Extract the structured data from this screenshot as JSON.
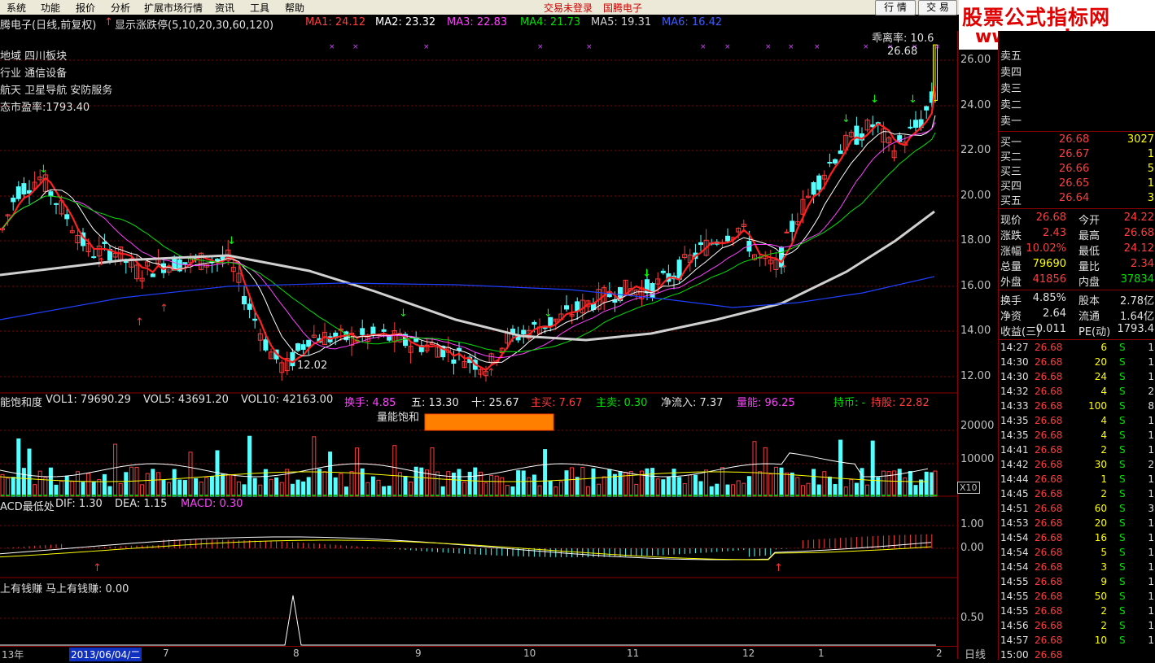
{
  "menu": [
    "系统",
    "功能",
    "报价",
    "分析",
    "扩展市场行情",
    "资讯",
    "工具",
    "帮助"
  ],
  "menu_center": [
    "交易未登录",
    "国腾电子"
  ],
  "buttons": {
    "fenshi": "行 情",
    "trade": "交 易"
  },
  "watermark": {
    "line1": "股票公式指标网",
    "line2": "www.gszb.com"
  },
  "header": {
    "stock": "腾电子(日线,前复权)",
    "toggle": "显示涨跌停(5,10,20,30,60,120)",
    "ma1": "MA1: 24.12",
    "ma2": "MA2: 23.32",
    "ma3": "MA3: 22.83",
    "ma4": "MA4: 21.73",
    "ma5": "MA5: 19.31",
    "ma6": "MA6: 16.42"
  },
  "overlay": {
    "line1": "地域 四川板块",
    "line2": "行业 通信设备",
    "line3": "航天 卫星导航 安防服务",
    "line4": "态市盈率:1793.40",
    "bias": "乖离率: 10.6",
    "high_label": "26.68",
    "low_label": "12.02"
  },
  "price_axis": [
    "26.00",
    "24.00",
    "22.00",
    "20.00",
    "18.00",
    "16.00",
    "14.00",
    "12.00"
  ],
  "vol_header": {
    "name": "能饱和度",
    "vol1": "VOL1: 79690.29",
    "vol5": "VOL5: 43691.20",
    "vol10": "VOL10: 42163.00",
    "hs": "换手: 4.85",
    "wu": "五: 13.30",
    "shi": "十: 25.67",
    "zhumai": "主买: 7.67",
    "zhumai2": "主卖: 0.30",
    "jlr": "净流入: 7.37",
    "ln": "量能: 96.25",
    "cb": "持币: -",
    "cg": "持股: 22.82",
    "bar_label": "量能饱和"
  },
  "vol_axis": [
    "20000",
    "10000",
    "X10"
  ],
  "macd_header": {
    "name": "ACD最低处",
    "dif": "DIF: 1.30",
    "dea": "DEA: 1.15",
    "macd": "MACD: 0.30"
  },
  "macd_axis": [
    "1.00",
    "0.00"
  ],
  "ind_header": {
    "name": "上有钱赚",
    "val": "马上有钱赚: 0.00"
  },
  "ind_axis": [
    "0.50"
  ],
  "date_axis": {
    "year": "13年",
    "cursor": "2013/06/04/二",
    "months": [
      "7",
      "8",
      "9",
      "10",
      "11",
      "12",
      "1",
      "2"
    ],
    "period": "日线"
  },
  "colors": {
    "up": "#ff3c3c",
    "down": "#54ffff",
    "grid": "#8b0000",
    "ma_white": "#ffffff",
    "ma_yellow": "#ffff00",
    "ma_mag": "#ff40ff",
    "ma_green": "#00e000",
    "ma_gray": "#d0d0d0",
    "ma_blue": "#2040ff"
  },
  "quote": {
    "asks": [
      {
        "l": "卖五"
      },
      {
        "l": "卖四"
      },
      {
        "l": "卖三"
      },
      {
        "l": "卖二"
      },
      {
        "l": "卖一"
      }
    ],
    "bids": [
      {
        "l": "买一",
        "p": "26.68",
        "v": "3027"
      },
      {
        "l": "买二",
        "p": "26.67",
        "v": "1"
      },
      {
        "l": "买三",
        "p": "26.66",
        "v": "5"
      },
      {
        "l": "买四",
        "p": "26.65",
        "v": "1"
      },
      {
        "l": "买五",
        "p": "26.64",
        "v": "3"
      }
    ],
    "stats": [
      {
        "a": "现价",
        "av": "26.68",
        "b": "今开",
        "bv": "24.22"
      },
      {
        "a": "涨跌",
        "av": "2.43",
        "b": "最高",
        "bv": "26.68"
      },
      {
        "a": "涨幅",
        "av": "10.02%",
        "b": "最低",
        "bv": "24.12"
      },
      {
        "a": "总量",
        "av": "79690",
        "b": "量比",
        "bv": "2.34"
      },
      {
        "a": "外盘",
        "av": "41856",
        "b": "内盘",
        "bv": "37834"
      }
    ],
    "fin": [
      {
        "a": "换手",
        "av": "4.85%",
        "b": "股本",
        "bv": "2.78亿"
      },
      {
        "a": "净资",
        "av": "2.64",
        "b": "流通",
        "bv": "1.64亿"
      },
      {
        "a": "收益(三)",
        "av": "0.011",
        "b": "PE(动)",
        "bv": "1793.4"
      }
    ],
    "ticks": [
      {
        "t": "14:27",
        "p": "26.68",
        "v": "6",
        "s": "S",
        "n": "1"
      },
      {
        "t": "14:30",
        "p": "26.68",
        "v": "20",
        "s": "S",
        "n": "1"
      },
      {
        "t": "14:30",
        "p": "26.68",
        "v": "24",
        "s": "S",
        "n": "1"
      },
      {
        "t": "14:32",
        "p": "26.68",
        "v": "4",
        "s": "S",
        "n": "2"
      },
      {
        "t": "14:33",
        "p": "26.68",
        "v": "100",
        "s": "S",
        "n": "8"
      },
      {
        "t": "14:35",
        "p": "26.68",
        "v": "4",
        "s": "S",
        "n": "1"
      },
      {
        "t": "14:35",
        "p": "26.68",
        "v": "4",
        "s": "S",
        "n": "1"
      },
      {
        "t": "14:41",
        "p": "26.68",
        "v": "2",
        "s": "S",
        "n": "1"
      },
      {
        "t": "14:42",
        "p": "26.68",
        "v": "30",
        "s": "S",
        "n": "2"
      },
      {
        "t": "14:44",
        "p": "26.68",
        "v": "1",
        "s": "S",
        "n": "1"
      },
      {
        "t": "14:45",
        "p": "26.68",
        "v": "2",
        "s": "S",
        "n": "1"
      },
      {
        "t": "14:51",
        "p": "26.68",
        "v": "60",
        "s": "S",
        "n": "3"
      },
      {
        "t": "14:53",
        "p": "26.68",
        "v": "20",
        "s": "S",
        "n": "1"
      },
      {
        "t": "14:54",
        "p": "26.68",
        "v": "16",
        "s": "S",
        "n": "1"
      },
      {
        "t": "14:54",
        "p": "26.68",
        "v": "5",
        "s": "S",
        "n": "1"
      },
      {
        "t": "14:54",
        "p": "26.68",
        "v": "3",
        "s": "S",
        "n": "1"
      },
      {
        "t": "14:55",
        "p": "26.68",
        "v": "9",
        "s": "S",
        "n": "1"
      },
      {
        "t": "14:55",
        "p": "26.68",
        "v": "50",
        "s": "S",
        "n": "1"
      },
      {
        "t": "14:55",
        "p": "26.68",
        "v": "2",
        "s": "S",
        "n": "1"
      },
      {
        "t": "14:56",
        "p": "26.68",
        "v": "2",
        "s": "S",
        "n": "1"
      },
      {
        "t": "14:57",
        "p": "26.68",
        "v": "10",
        "s": "S",
        "n": "1"
      },
      {
        "t": "15:00",
        "p": "26.68",
        "v": "",
        "s": "",
        "n": ""
      }
    ]
  }
}
